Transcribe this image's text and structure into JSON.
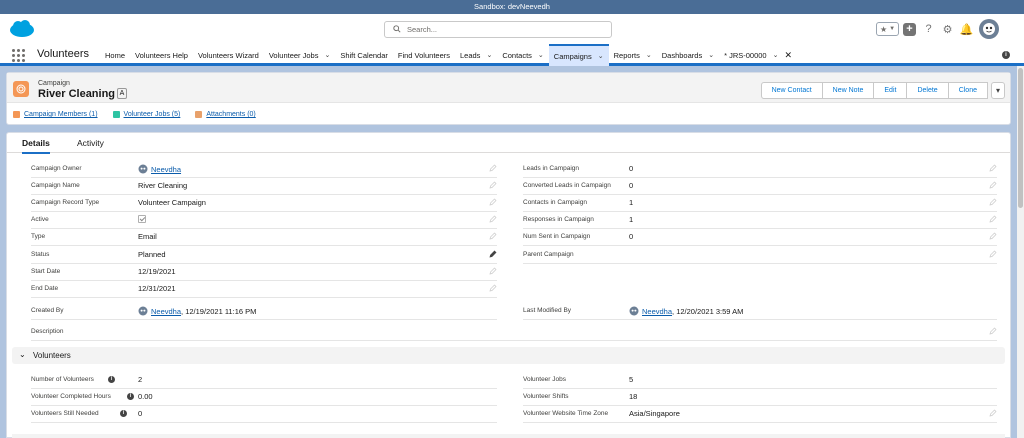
{
  "sandbox": {
    "label": "Sandbox: devNeevedh"
  },
  "header": {
    "search_placeholder": "Search..."
  },
  "nav": {
    "app_name": "Volunteers",
    "items": [
      {
        "label": "Home",
        "dropdown": false
      },
      {
        "label": "Volunteers Help",
        "dropdown": false
      },
      {
        "label": "Volunteers Wizard",
        "dropdown": false
      },
      {
        "label": "Volunteer Jobs",
        "dropdown": true
      },
      {
        "label": "Shift Calendar",
        "dropdown": false
      },
      {
        "label": "Find Volunteers",
        "dropdown": false
      },
      {
        "label": "Leads",
        "dropdown": true
      },
      {
        "label": "Contacts",
        "dropdown": true
      },
      {
        "label": "Campaigns",
        "dropdown": true,
        "active": true
      },
      {
        "label": "Reports",
        "dropdown": true
      },
      {
        "label": "Dashboards",
        "dropdown": true
      },
      {
        "label": "* JRS-00000",
        "dropdown": true,
        "closable": true
      }
    ]
  },
  "record": {
    "object": "Campaign",
    "name": "River Cleaning",
    "flag": "A",
    "buttons": [
      "New Contact",
      "New Note",
      "Edit",
      "Delete",
      "Clone"
    ],
    "related": [
      {
        "label": "Campaign Members (1)",
        "color": "#f49756"
      },
      {
        "label": "Volunteer Jobs (5)",
        "color": "#2ec4a3"
      },
      {
        "label": "Attachments (0)",
        "color": "#e8a16b"
      }
    ]
  },
  "tabs": {
    "details": "Details",
    "activity": "Activity"
  },
  "fields_left": [
    {
      "label": "Campaign Owner",
      "value": "Neevdha",
      "link": true
    },
    {
      "label": "Campaign Name",
      "value": "River Cleaning"
    },
    {
      "label": "Campaign Record Type",
      "value": "Volunteer Campaign"
    },
    {
      "label": "Active",
      "value": ""
    },
    {
      "label": "Type",
      "value": "Email"
    },
    {
      "label": "Status",
      "value": "Planned"
    },
    {
      "label": "Start Date",
      "value": "12/19/2021"
    },
    {
      "label": "End Date",
      "value": "12/31/2021"
    }
  ],
  "fields_right": [
    {
      "label": "Leads in Campaign",
      "value": "0"
    },
    {
      "label": "Converted Leads in Campaign",
      "value": "0"
    },
    {
      "label": "Contacts in Campaign",
      "value": "1"
    },
    {
      "label": "Responses in Campaign",
      "value": "1"
    },
    {
      "label": "Num Sent in Campaign",
      "value": "0"
    },
    {
      "label": "Parent Campaign",
      "value": ""
    }
  ],
  "created": {
    "label": "Created By",
    "user": "Neevdha",
    "date": ", 12/19/2021 11:16 PM"
  },
  "modified": {
    "label": "Last Modified By",
    "user": "Neevdha",
    "date": ", 12/20/2021 3:59 AM"
  },
  "description": {
    "label": "Description"
  },
  "section": {
    "title": "Volunteers"
  },
  "vol_left": [
    {
      "label": "Number of Volunteers",
      "value": "2"
    },
    {
      "label": "Volunteer Completed Hours",
      "value": "0.00"
    },
    {
      "label": "Volunteers Still Needed",
      "value": "0"
    }
  ],
  "vol_right": [
    {
      "label": "Volunteer Jobs",
      "value": "5"
    },
    {
      "label": "Volunteer Shifts",
      "value": "18"
    },
    {
      "label": "Volunteer Website Time Zone",
      "value": "Asia/Singapore"
    }
  ]
}
